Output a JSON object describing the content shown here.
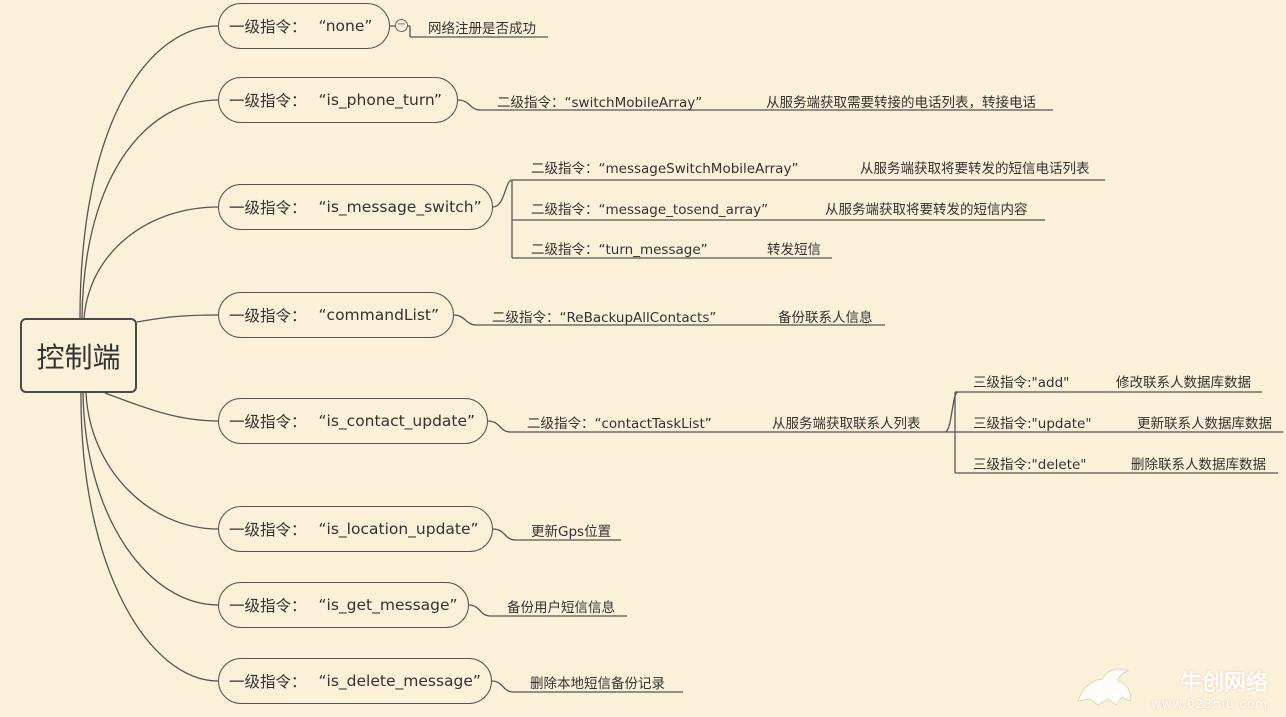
{
  "root": {
    "label": "控制端"
  },
  "l1_prefix": "一级指令：",
  "commands": [
    {
      "name": "“none”",
      "children": [
        {
          "text": "网络注册是否成功"
        }
      ]
    },
    {
      "name": "“is_phone_turn”",
      "children": [
        {
          "text": "二级指令：“switchMobileArray”",
          "desc": "从服务端获取需要转接的电话列表，转接电话"
        }
      ]
    },
    {
      "name": "“is_message_switch”",
      "children": [
        {
          "text": "二级指令：“messageSwitchMobileArray”",
          "desc": "从服务端获取将要转发的短信电话列表"
        },
        {
          "text": "二级指令：“message_tosend_array”",
          "desc": "从服务端获取将要转发的短信内容"
        },
        {
          "text": "二级指令：“turn_message”",
          "desc": "转发短信"
        }
      ]
    },
    {
      "name": "“commandList”",
      "children": [
        {
          "text": "二级指令：“ReBackupAllContacts”",
          "desc": "备份联系人信息"
        }
      ]
    },
    {
      "name": "“is_contact_update”",
      "children": [
        {
          "text": "二级指令：“contactTaskList”",
          "desc": "从服务端获取联系人列表",
          "children": [
            {
              "text": "三级指令:\"add\"",
              "desc": "修改联系人数据库数据"
            },
            {
              "text": "三级指令:\"update\"",
              "desc": "更新联系人数据库数据"
            },
            {
              "text": "三级指令:\"delete\"",
              "desc": "删除联系人数据库数据"
            }
          ]
        }
      ]
    },
    {
      "name": "“is_location_update”",
      "children": [
        {
          "text": "更新Gps位置"
        }
      ]
    },
    {
      "name": "“is_get_message”",
      "children": [
        {
          "text": "备份用户短信信息"
        }
      ]
    },
    {
      "name": "“is_delete_message”",
      "children": [
        {
          "text": "删除本地短信备份记录"
        }
      ]
    }
  ],
  "collapse_icon": "−",
  "watermark": {
    "brand": "牛创网络",
    "url": "www.023niu.com"
  },
  "colors": {
    "background": "#fbf1d8",
    "line": "#555555"
  }
}
